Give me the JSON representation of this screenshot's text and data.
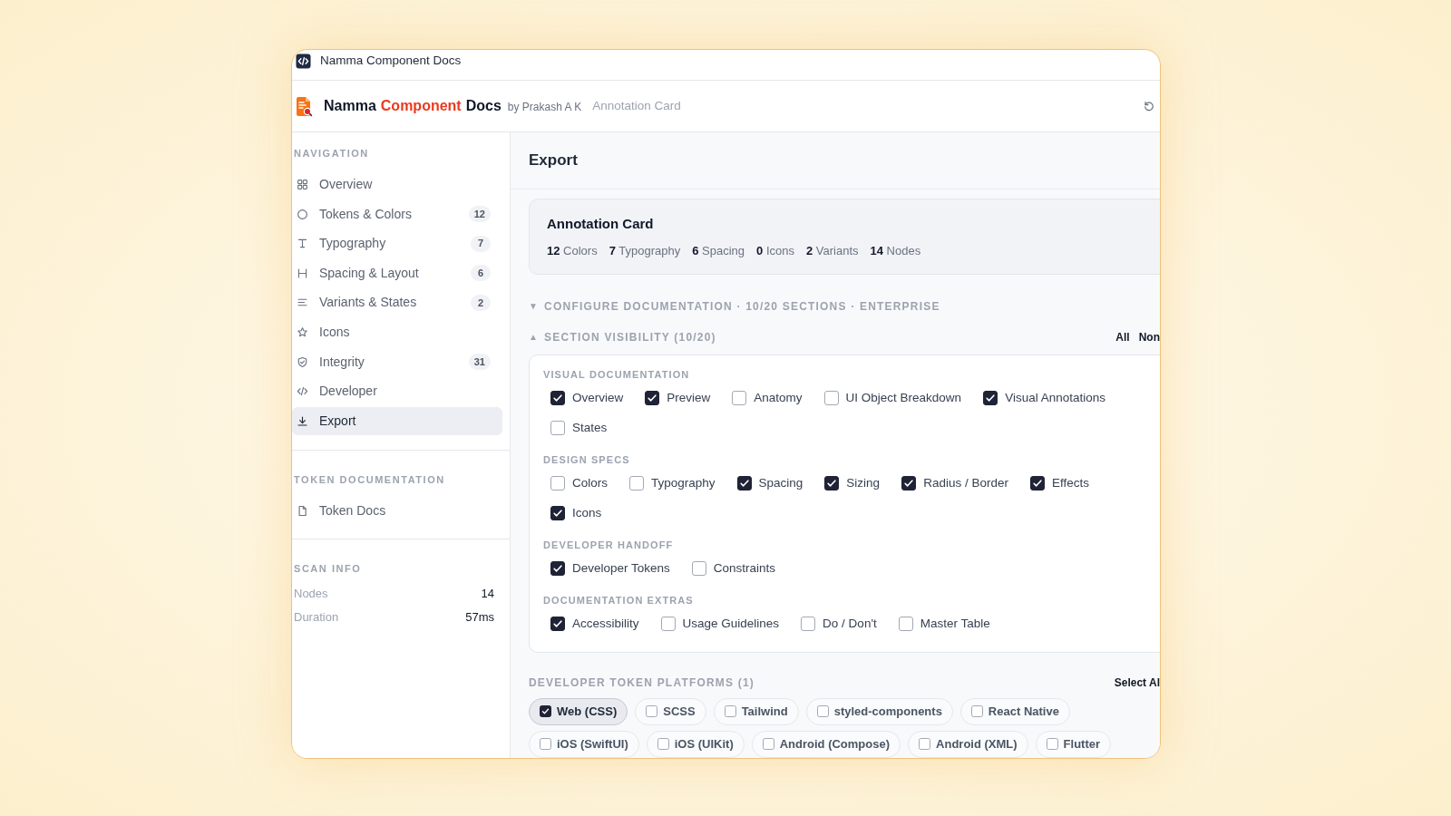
{
  "window": {
    "title": "Namma Component Docs"
  },
  "header": {
    "brand": [
      {
        "text": "Namma",
        "accent": false
      },
      {
        "text": "Component",
        "accent": true
      },
      {
        "text": "Docs",
        "accent": false
      }
    ],
    "byline": "by Prakash A K",
    "context": "Annotation Card"
  },
  "sidebar": {
    "navigation": {
      "title": "NAVIGATION",
      "items": [
        {
          "label": "Overview",
          "selected": false
        },
        {
          "label": "Tokens & Colors",
          "badge": "12",
          "selected": false
        },
        {
          "label": "Typography",
          "badge": "7",
          "selected": false
        },
        {
          "label": "Spacing & Layout",
          "badge": "6",
          "selected": false
        },
        {
          "label": "Variants & States",
          "badge": "2",
          "selected": false
        },
        {
          "label": "Icons",
          "selected": false
        },
        {
          "label": "Integrity",
          "badge": "31",
          "selected": false
        },
        {
          "label": "Developer",
          "selected": false
        },
        {
          "label": "Export",
          "selected": true
        }
      ]
    },
    "token_documentation": {
      "title": "TOKEN DOCUMENTATION",
      "items": [
        {
          "label": "Token Docs",
          "selected": false
        }
      ]
    },
    "scan_info": {
      "title": "SCAN INFO",
      "rows": [
        {
          "label": "Nodes",
          "value": "14"
        },
        {
          "label": "Duration",
          "value": "57ms"
        }
      ]
    }
  },
  "main": {
    "title": "Export",
    "summary": {
      "title": "Annotation Card",
      "stats": [
        "**12** Colors",
        "**7** Typography",
        "**6** Spacing",
        "**0** Icons",
        "**2** Variants",
        "**14** Nodes"
      ]
    },
    "configure": {
      "arrow": "▼",
      "label": "CONFIGURE DOCUMENTATION · 10/20 SECTIONS · ENTERPRISE"
    },
    "section_visibility": {
      "arrow": "▲",
      "label": "SECTION VISIBILITY (10/20)",
      "actions": [
        "All",
        "Non"
      ],
      "groups": [
        {
          "title": "VISUAL DOCUMENTATION",
          "options": [
            {
              "label": "Overview",
              "checked": true
            },
            {
              "label": "Preview",
              "checked": true
            },
            {
              "label": "Anatomy",
              "checked": false
            },
            {
              "label": "UI Object Breakdown",
              "checked": false
            },
            {
              "label": "Visual Annotations",
              "checked": true
            },
            {
              "label": "States",
              "checked": false
            }
          ]
        },
        {
          "title": "DESIGN SPECS",
          "options": [
            {
              "label": "Colors",
              "checked": false
            },
            {
              "label": "Typography",
              "checked": false
            },
            {
              "label": "Spacing",
              "checked": true
            },
            {
              "label": "Sizing",
              "checked": true
            },
            {
              "label": "Radius / Border",
              "checked": true
            },
            {
              "label": "Effects",
              "checked": true
            },
            {
              "label": "Icons",
              "checked": true
            }
          ]
        },
        {
          "title": "DEVELOPER HANDOFF",
          "options": [
            {
              "label": "Developer Tokens",
              "checked": true
            },
            {
              "label": "Constraints",
              "checked": false
            }
          ]
        },
        {
          "title": "DOCUMENTATION EXTRAS",
          "options": [
            {
              "label": "Accessibility",
              "checked": true
            },
            {
              "label": "Usage Guidelines",
              "checked": false
            },
            {
              "label": "Do / Don't",
              "checked": false
            },
            {
              "label": "Master Table",
              "checked": false
            }
          ]
        }
      ]
    },
    "platforms": {
      "label": "DEVELOPER TOKEN PLATFORMS (1)",
      "action": "Select Al",
      "chips": [
        {
          "label": "Web (CSS)",
          "checked": true
        },
        {
          "label": "SCSS",
          "checked": false
        },
        {
          "label": "Tailwind",
          "checked": false
        },
        {
          "label": "styled-components",
          "checked": false
        },
        {
          "label": "React Native",
          "checked": false
        },
        {
          "label": "iOS (SwiftUI)",
          "checked": false
        },
        {
          "label": "iOS (UIKit)",
          "checked": false
        },
        {
          "label": "Android (Compose)",
          "checked": false
        },
        {
          "label": "Android (XML)",
          "checked": false
        },
        {
          "label": "Flutter",
          "checked": false
        }
      ]
    }
  }
}
